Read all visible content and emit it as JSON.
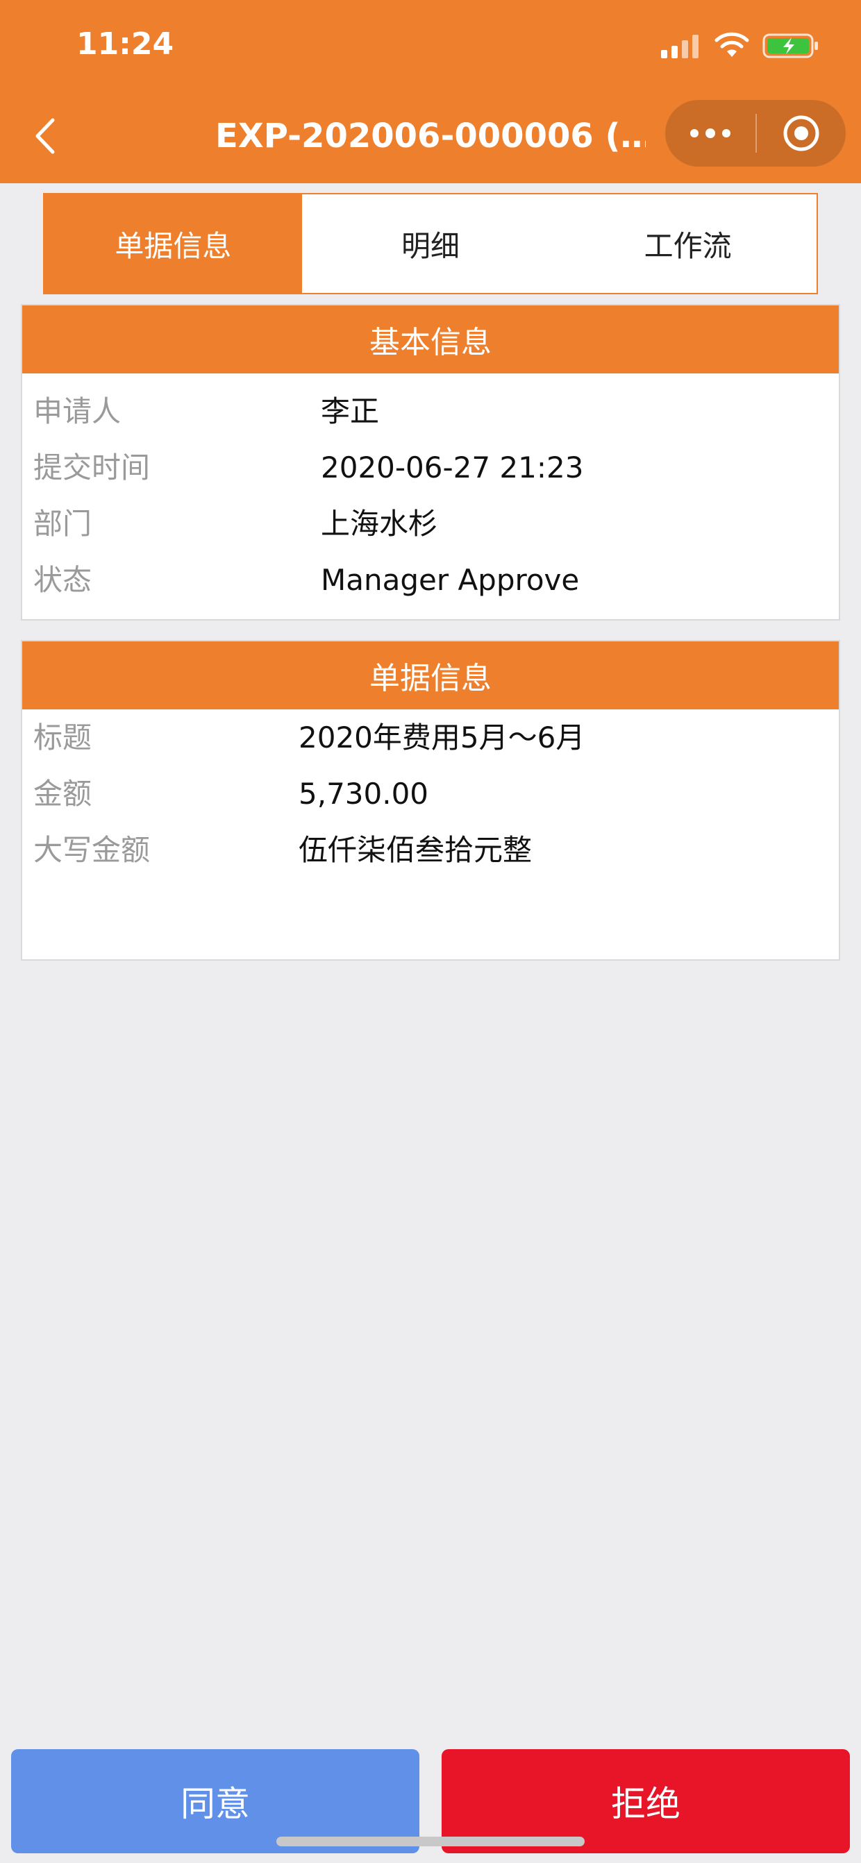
{
  "status_bar": {
    "time": "11:24"
  },
  "nav": {
    "title": "EXP-202006-000006 (…"
  },
  "tabs": [
    {
      "label": "单据信息",
      "active": true
    },
    {
      "label": "明细",
      "active": false
    },
    {
      "label": "工作流",
      "active": false
    }
  ],
  "basic_info": {
    "title": "基本信息",
    "rows": [
      {
        "label": "申请人",
        "value": "李正"
      },
      {
        "label": "提交时间",
        "value": "2020-06-27 21:23"
      },
      {
        "label": "部门",
        "value": "上海水杉"
      },
      {
        "label": "状态",
        "value": "Manager Approve"
      }
    ]
  },
  "bill_info": {
    "title": "单据信息",
    "rows": [
      {
        "label": "标题",
        "value": "2020年费用5月～6月"
      },
      {
        "label": "金额",
        "value": "5,730.00"
      },
      {
        "label": "大写金额",
        "value": "伍仟柒佰叁拾元整"
      }
    ]
  },
  "actions": {
    "approve_label": "同意",
    "reject_label": "拒绝"
  },
  "colors": {
    "accent": "#ed7f2d",
    "approve": "#6090e8",
    "reject": "#e81528",
    "background": "#ededf0"
  }
}
